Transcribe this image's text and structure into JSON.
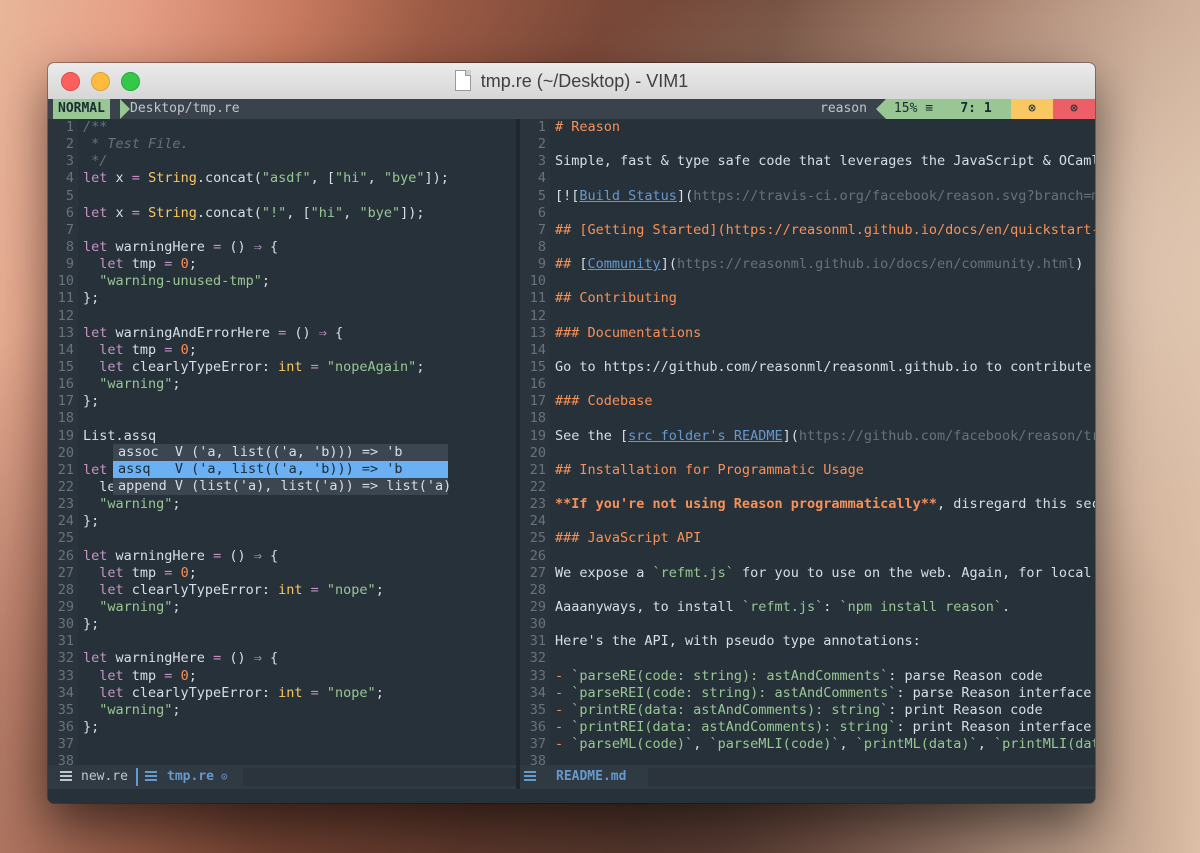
{
  "window": {
    "title": "tmp.re (~/Desktop) - VIM1"
  },
  "statusline_top": {
    "mode": "NORMAL",
    "path": "Desktop/tmp.re",
    "filetype": "reason",
    "percent": "15% ≡",
    "position": "7:  1",
    "warning_icon": "⊗",
    "error_icon": "⊗",
    "colors": {
      "mode_bg": "#99c794",
      "warning_bg": "#fac863",
      "error_bg": "#ec5f67"
    }
  },
  "left_buffer": {
    "lines": [
      {
        "n": "1",
        "t": "/**"
      },
      {
        "n": "2",
        "t": " * Test File."
      },
      {
        "n": "3",
        "t": " */"
      },
      {
        "n": "4",
        "t": "let x = String.concat(\"asdf\", [\"hi\", \"bye\"]);"
      },
      {
        "n": "5",
        "t": ""
      },
      {
        "n": "6",
        "t": "let x = String.concat(\"!\", [\"hi\", \"bye\"]);"
      },
      {
        "n": "7",
        "t": ""
      },
      {
        "n": "8",
        "t": "let warningHere = () => {"
      },
      {
        "n": "9",
        "t": "  let tmp = 0;"
      },
      {
        "n": "10",
        "t": "  \"warning-unused-tmp\";"
      },
      {
        "n": "11",
        "t": "};"
      },
      {
        "n": "12",
        "t": ""
      },
      {
        "n": "13",
        "t": "let warningAndErrorHere = () => {"
      },
      {
        "n": "14",
        "t": "  let tmp = 0;"
      },
      {
        "n": "15",
        "t": "  let clearlyTypeError: int = \"nopeAgain\";"
      },
      {
        "n": "16",
        "t": "  \"warning\";"
      },
      {
        "n": "17",
        "t": "};"
      },
      {
        "n": "18",
        "t": ""
      },
      {
        "n": "19",
        "t": "List.assq"
      },
      {
        "n": "20",
        "t": ""
      },
      {
        "n": "21",
        "t": "let"
      },
      {
        "n": "22",
        "t": "  le"
      },
      {
        "n": "23",
        "t": "  \"warning\";"
      },
      {
        "n": "24",
        "t": "};"
      },
      {
        "n": "25",
        "t": ""
      },
      {
        "n": "26",
        "t": "let warningHere = () => {"
      },
      {
        "n": "27",
        "t": "  let tmp = 0;"
      },
      {
        "n": "28",
        "t": "  let clearlyTypeError: int = \"nope\";"
      },
      {
        "n": "29",
        "t": "  \"warning\";"
      },
      {
        "n": "30",
        "t": "};"
      },
      {
        "n": "31",
        "t": ""
      },
      {
        "n": "32",
        "t": "let warningHere = () => {"
      },
      {
        "n": "33",
        "t": "  let tmp = 0;"
      },
      {
        "n": "34",
        "t": "  let clearlyTypeError: int = \"nope\";"
      },
      {
        "n": "35",
        "t": "  \"warning\";"
      },
      {
        "n": "36",
        "t": "};"
      },
      {
        "n": "37",
        "t": ""
      },
      {
        "n": "38",
        "t": ""
      }
    ],
    "completion": [
      {
        "label": "assoc  V ('a, list(('a, 'b))) => 'b",
        "selected": false
      },
      {
        "label": "assq   V ('a, list(('a, 'b))) => 'b",
        "selected": true
      },
      {
        "label": "append V (list('a), list('a)) => list('a)",
        "selected": false
      }
    ]
  },
  "right_buffer": {
    "lines": [
      {
        "n": "1",
        "t": "# Reason"
      },
      {
        "n": "2",
        "t": ""
      },
      {
        "n": "3",
        "t": "Simple, fast & type safe code that leverages the JavaScript & OCaml e"
      },
      {
        "n": "4",
        "t": ""
      },
      {
        "n": "5",
        "t": "[![Build Status](https://travis-ci.org/facebook/reason.svg?branch=mas"
      },
      {
        "n": "6",
        "t": ""
      },
      {
        "n": "7",
        "t": "## [Getting Started](https://reasonml.github.io/docs/en/quickstart-ja"
      },
      {
        "n": "8",
        "t": ""
      },
      {
        "n": "9",
        "t": "## [Community](https://reasonml.github.io/docs/en/community.html)"
      },
      {
        "n": "10",
        "t": ""
      },
      {
        "n": "11",
        "t": "## Contributing"
      },
      {
        "n": "12",
        "t": ""
      },
      {
        "n": "13",
        "t": "### Documentations"
      },
      {
        "n": "14",
        "t": ""
      },
      {
        "n": "15",
        "t": "Go to https://github.com/reasonml/reasonml.github.io to contribute to"
      },
      {
        "n": "16",
        "t": ""
      },
      {
        "n": "17",
        "t": "### Codebase"
      },
      {
        "n": "18",
        "t": ""
      },
      {
        "n": "19",
        "t": "See the [src folder's README](https://github.com/facebook/reason/tree"
      },
      {
        "n": "20",
        "t": ""
      },
      {
        "n": "21",
        "t": "## Installation for Programmatic Usage"
      },
      {
        "n": "22",
        "t": ""
      },
      {
        "n": "23",
        "t": "**If you're not using Reason programmatically**, disregard this secti"
      },
      {
        "n": "24",
        "t": ""
      },
      {
        "n": "25",
        "t": "### JavaScript API"
      },
      {
        "n": "26",
        "t": ""
      },
      {
        "n": "27",
        "t": "We expose a `refmt.js` for you to use on the web. Again, for local de"
      },
      {
        "n": "28",
        "t": ""
      },
      {
        "n": "29",
        "t": "Aaaanyways, to install `refmt.js`: `npm install reason`."
      },
      {
        "n": "30",
        "t": ""
      },
      {
        "n": "31",
        "t": "Here's the API, with pseudo type annotations:"
      },
      {
        "n": "32",
        "t": ""
      },
      {
        "n": "33",
        "t": "- `parseRE(code: string): astAndComments`: parse Reason code"
      },
      {
        "n": "34",
        "t": "- `parseREI(code: string): astAndComments`: parse Reason interface co"
      },
      {
        "n": "35",
        "t": "- `printRE(data: astAndComments): string`: print Reason code"
      },
      {
        "n": "36",
        "t": "- `printREI(data: astAndComments): string`: print Reason interface co"
      },
      {
        "n": "37",
        "t": "- `parseML(code)`, `parseMLI(code)`, `printML(data)`, `printMLI(data)"
      },
      {
        "n": "38",
        "t": ""
      }
    ]
  },
  "statusline_bottom": {
    "tabs": [
      {
        "label": "new.re",
        "icon": "buffer-list-icon"
      },
      {
        "label": "tmp.re",
        "icon": "buffer-list-icon",
        "modified": "⊙"
      },
      {
        "label": "README.md",
        "icon": "buffer-list-icon"
      }
    ]
  }
}
